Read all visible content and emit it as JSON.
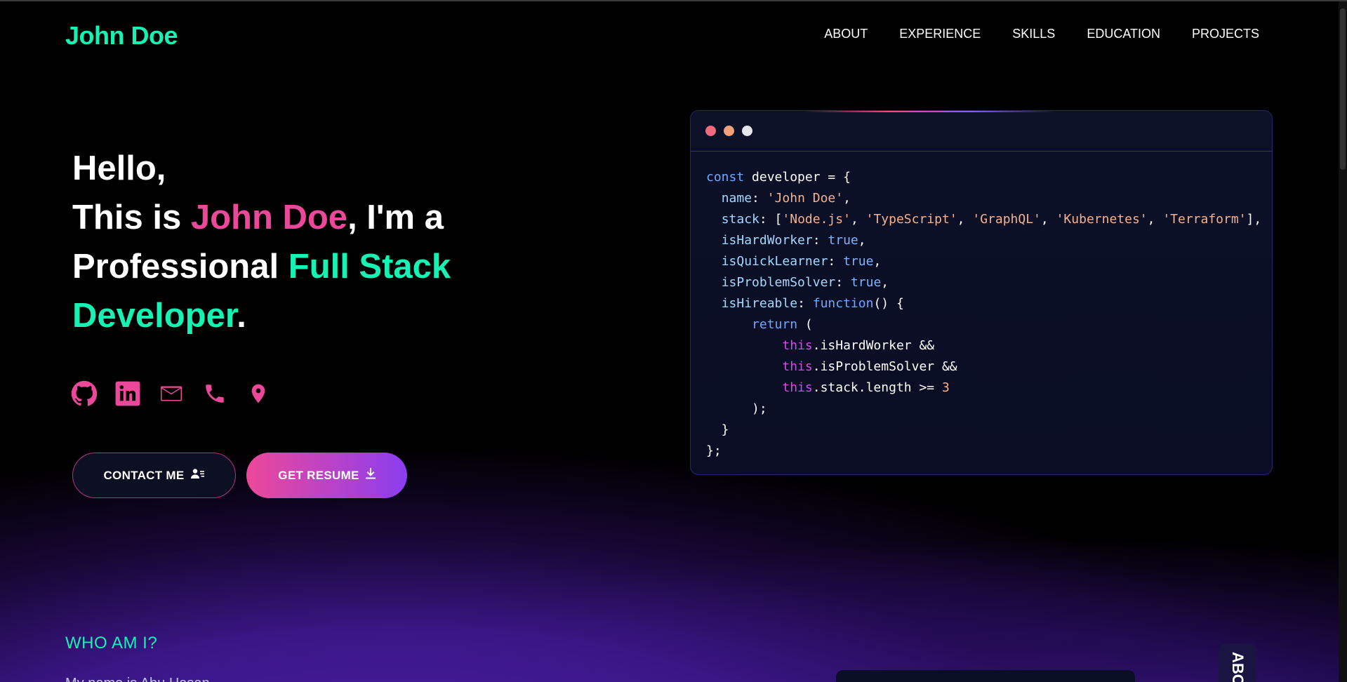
{
  "header": {
    "logo": "John Doe",
    "nav": [
      "ABOUT",
      "EXPERIENCE",
      "SKILLS",
      "EDUCATION",
      "PROJECTS"
    ]
  },
  "hero": {
    "line1": "Hello,",
    "line2_prefix": "This is ",
    "name": "John Doe",
    "line2_suffix": ", I'm a",
    "line3_prefix": "Professional ",
    "role_part1": "Full Stack",
    "role_part2": "Developer",
    "period": "."
  },
  "socials": [
    "github-icon",
    "linkedin-icon",
    "mail-icon",
    "phone-icon",
    "location-icon"
  ],
  "buttons": {
    "contact": "CONTACT ME",
    "resume": "GET RESUME"
  },
  "code": {
    "line1_kw": "const",
    "line1_var": "developer",
    "line1_rest": " = {",
    "name_key": "name",
    "name_val": "'John Doe'",
    "stack_key": "stack",
    "stack_items": [
      "'Node.js'",
      "'TypeScript'",
      "'GraphQL'",
      "'Kubernetes'",
      "'Terraform'"
    ],
    "hw_key": "isHardWorker",
    "ql_key": "isQuickLearner",
    "ps_key": "isProblemSolver",
    "bool_true": "true",
    "hire_key": "isHireable",
    "fn_kw": "function",
    "return_kw": "return",
    "this_kw": "this",
    "ret1": ".isHardWorker &&",
    "ret2": ".isProblemSolver &&",
    "ret3": ".stack.length >= ",
    "num": "3"
  },
  "colors": {
    "accent_green": "#16f2b3",
    "accent_pink": "#ec4899",
    "accent_purple": "#8b3df0"
  },
  "section": {
    "who_title": "WHO AM I?",
    "who_sub": "My name is Abu Hasan Nizam",
    "about_tab": "ABOUT"
  }
}
